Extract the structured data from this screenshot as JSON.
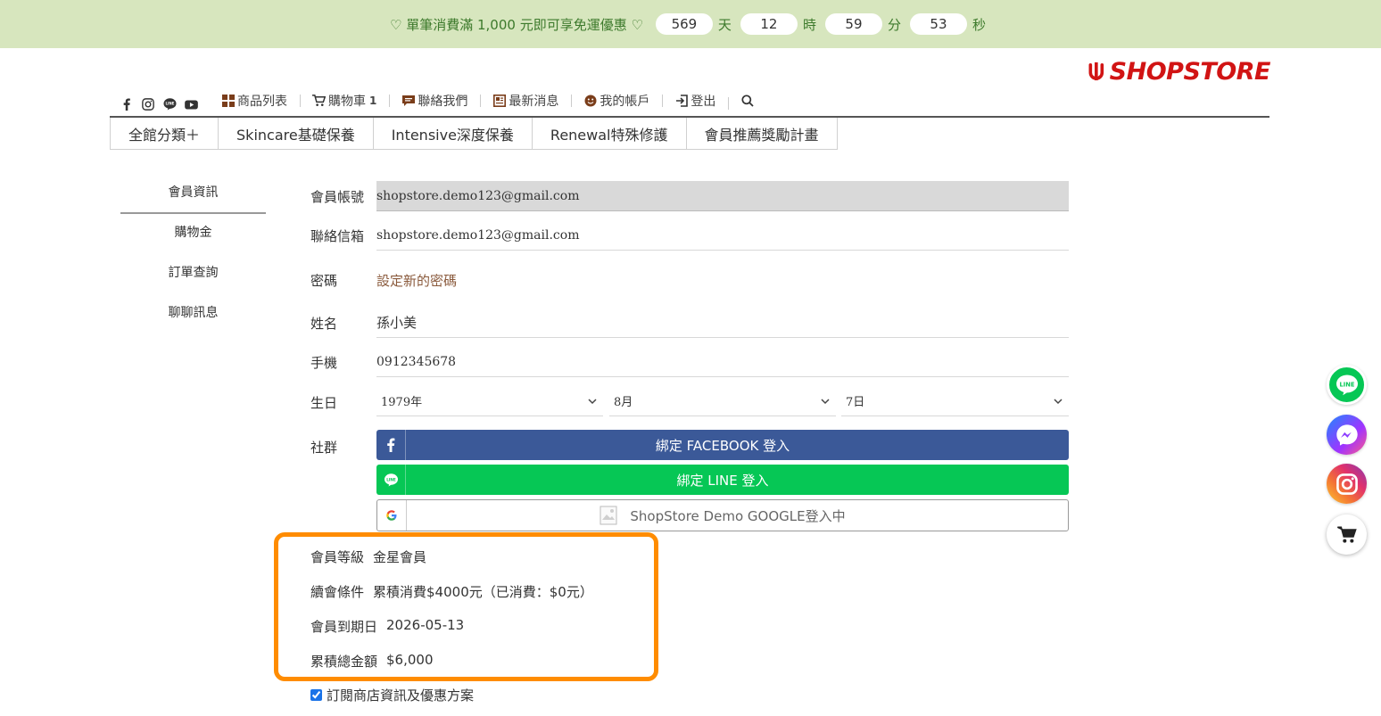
{
  "promo": {
    "text": "♡ 單筆消費滿 1,000 元即可享免運優惠 ♡",
    "countdown": [
      {
        "value": "569",
        "unit": "天"
      },
      {
        "value": "12",
        "unit": "時"
      },
      {
        "value": "59",
        "unit": "分"
      },
      {
        "value": "53",
        "unit": "秒"
      }
    ]
  },
  "brand": {
    "logo_text": "SHOPSTORE",
    "logo_color": "#d11414"
  },
  "top_nav": {
    "product_list": "商品列表",
    "cart": "購物車",
    "cart_count": "1",
    "contact": "聯絡我們",
    "news": "最新消息",
    "account": "我的帳戶",
    "logout": "登出"
  },
  "categories": [
    {
      "label": "全館分類＋"
    },
    {
      "label": "Skincare基礎保養"
    },
    {
      "label": "Intensive深度保養"
    },
    {
      "label": "Renewal特殊修護"
    },
    {
      "label": "會員推薦獎勵計畫"
    }
  ],
  "sidebar": {
    "items": [
      {
        "label": "會員資訊"
      },
      {
        "label": "購物金"
      },
      {
        "label": "訂單查詢"
      },
      {
        "label": "聊聊訊息"
      }
    ]
  },
  "form": {
    "account_label": "會員帳號",
    "account_value": "shopstore.demo123@gmail.com",
    "email_label": "聯絡信箱",
    "email_value": "shopstore.demo123@gmail.com",
    "password_label": "密碼",
    "password_link": "設定新的密碼",
    "name_label": "姓名",
    "name_value": "孫小美",
    "phone_label": "手機",
    "phone_value": "0912345678",
    "birthday_label": "生日",
    "birth_year": "1979年",
    "birth_month": "8月",
    "birth_day": "7日",
    "social_label": "社群",
    "facebook_button": "綁定 FACEBOOK 登入",
    "line_button": "綁定 LINE 登入",
    "google_button": "ShopStore Demo GOOGLE登入中"
  },
  "membership": {
    "level_label": "會員等級",
    "level_value": "金星會員",
    "renew_label": "續會條件",
    "renew_value": "累積消費$4000元（已消費：$0元）",
    "expiry_label": "會員到期日",
    "expiry_value": "2026-05-13",
    "total_label": "累積總金額",
    "total_value": "$6,000"
  },
  "subscribe": {
    "label": "訂閱商店資訊及優惠方案",
    "checked": true
  },
  "colors": {
    "promo_bg": "#d7e6be",
    "facebook": "#3b5998",
    "line": "#06c755",
    "highlight": "#ff8c00"
  }
}
